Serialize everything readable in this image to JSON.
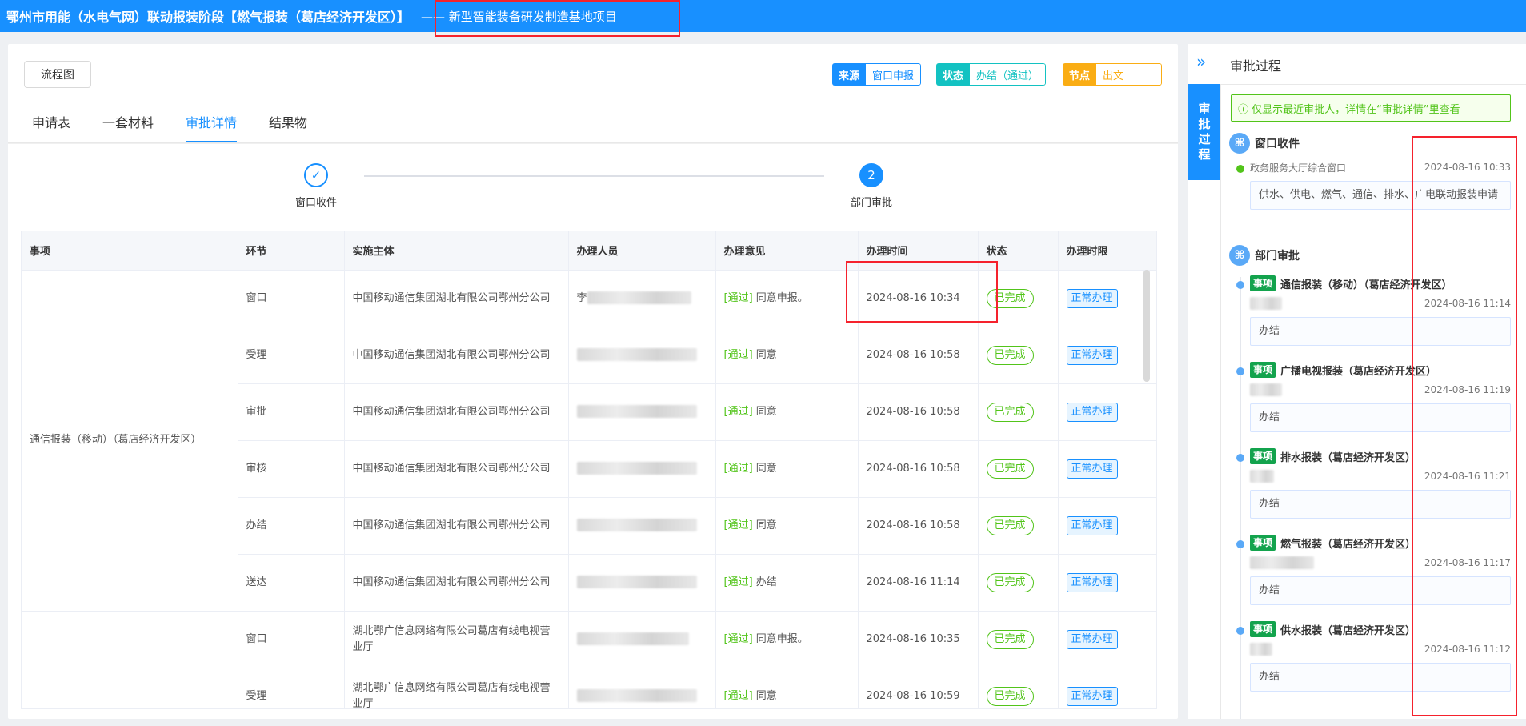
{
  "topbar": {
    "title": "鄂州市用能（水电气网）联动报装阶段【燃气报装（葛店经济开发区）】",
    "project": "—— 新型智能装备研发制造基地项目"
  },
  "toolbar": {
    "flow_label": "流程图"
  },
  "meta": [
    {
      "key": "来源",
      "value": "窗口申报",
      "color": "#1890ff"
    },
    {
      "key": "状态",
      "value": "办结（通过）",
      "color": "#13c2c2"
    },
    {
      "key": "节点",
      "value": "出文",
      "color": "#faad14"
    }
  ],
  "tabs": [
    {
      "label": "申请表"
    },
    {
      "label": "一套材料"
    },
    {
      "label": "审批详情",
      "active": true
    },
    {
      "label": "结果物"
    }
  ],
  "steps": [
    {
      "label": "窗口收件",
      "icon": "check-icon",
      "mark": "✓"
    },
    {
      "label": "部门审批",
      "icon": "step-number",
      "mark": "2"
    }
  ],
  "table": {
    "headers": [
      "事项",
      "环节",
      "实施主体",
      "办理人员",
      "办理意见",
      "办理时间",
      "状态",
      "办理时限"
    ],
    "pass_tag": "[通过]",
    "groups": [
      {
        "item": "通信报装（移动）（葛店经济开发区）",
        "rows": [
          {
            "stage": "窗口",
            "entity": "中国移动通信集团湖北有限公司鄂州分公司",
            "person": "李",
            "opinion": "同意申报。",
            "time": "2024-08-16 10:34",
            "status": "已完成",
            "limit": "正常办理"
          },
          {
            "stage": "受理",
            "entity": "中国移动通信集团湖北有限公司鄂州分公司",
            "person": "",
            "opinion": "同意",
            "time": "2024-08-16 10:58",
            "status": "已完成",
            "limit": "正常办理"
          },
          {
            "stage": "审批",
            "entity": "中国移动通信集团湖北有限公司鄂州分公司",
            "person": "",
            "opinion": "同意",
            "time": "2024-08-16 10:58",
            "status": "已完成",
            "limit": "正常办理"
          },
          {
            "stage": "审核",
            "entity": "中国移动通信集团湖北有限公司鄂州分公司",
            "person": "",
            "opinion": "同意",
            "time": "2024-08-16 10:58",
            "status": "已完成",
            "limit": "正常办理"
          },
          {
            "stage": "办结",
            "entity": "中国移动通信集团湖北有限公司鄂州分公司",
            "person": "",
            "opinion": "同意",
            "time": "2024-08-16 10:58",
            "status": "已完成",
            "limit": "正常办理"
          },
          {
            "stage": "送达",
            "entity": "中国移动通信集团湖北有限公司鄂州分公司",
            "person": "",
            "opinion": "办结",
            "time": "2024-08-16 11:14",
            "status": "已完成",
            "limit": "正常办理"
          }
        ]
      },
      {
        "item": "",
        "rows": [
          {
            "stage": "窗口",
            "entity": "湖北鄂广信息网络有限公司葛店有线电视营业厅",
            "person": "",
            "opinion": "同意申报。",
            "time": "2024-08-16 10:35",
            "status": "已完成",
            "limit": "正常办理"
          },
          {
            "stage": "受理",
            "entity": "湖北鄂广信息网络有限公司葛店有线电视营业厅",
            "person": "",
            "opinion": "同意",
            "time": "2024-08-16 10:59",
            "status": "已完成",
            "limit": "正常办理"
          }
        ]
      }
    ]
  },
  "side": {
    "strip_label": "审批过程",
    "title": "审批过程",
    "notice": "ⓘ 仅显示最近审批人，详情在“审批详情”里查看",
    "item_tag": "事项",
    "window_group": {
      "title": "窗口收件",
      "office": "政务服务大厅综合窗口",
      "time": "2024-08-16 10:33",
      "content": "供水、供电、燃气、通信、排水、广电联动报装申请"
    },
    "dept_group": {
      "title": "部门审批",
      "items": [
        {
          "name": "通信报装（移动）（葛店经济开发区）",
          "time": "2024-08-16 11:14",
          "content": "办结"
        },
        {
          "name": "广播电视报装（葛店经济开发区）",
          "time": "2024-08-16 11:19",
          "content": "办结"
        },
        {
          "name": "排水报装（葛店经济开发区）",
          "time": "2024-08-16 11:21",
          "content": "办结"
        },
        {
          "name": "燃气报装（葛店经济开发区）",
          "time": "2024-08-16 11:17",
          "content": "办结"
        },
        {
          "name": "供水报装（葛店经济开发区）",
          "time": "2024-08-16 11:12",
          "content": "办结"
        }
      ]
    }
  }
}
